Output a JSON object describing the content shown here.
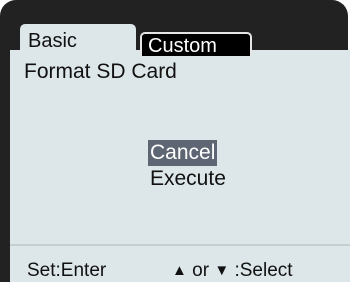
{
  "tabs": [
    {
      "label": "Basic",
      "active": true
    },
    {
      "label": "Custom",
      "active": false
    }
  ],
  "dialog": {
    "title": "Format SD Card",
    "options": [
      {
        "label": "Cancel",
        "selected": true
      },
      {
        "label": "Execute",
        "selected": false
      }
    ]
  },
  "footer": {
    "enter_hint": "Set:Enter",
    "up_icon": "triangle-up-icon",
    "or_text": "or",
    "down_icon": "triangle-down-icon",
    "select_text": ":Select"
  },
  "colors": {
    "panel": "#dde6e8",
    "bezel": "#222222",
    "selection": "#5e6674",
    "custom_tab": "#000000"
  }
}
